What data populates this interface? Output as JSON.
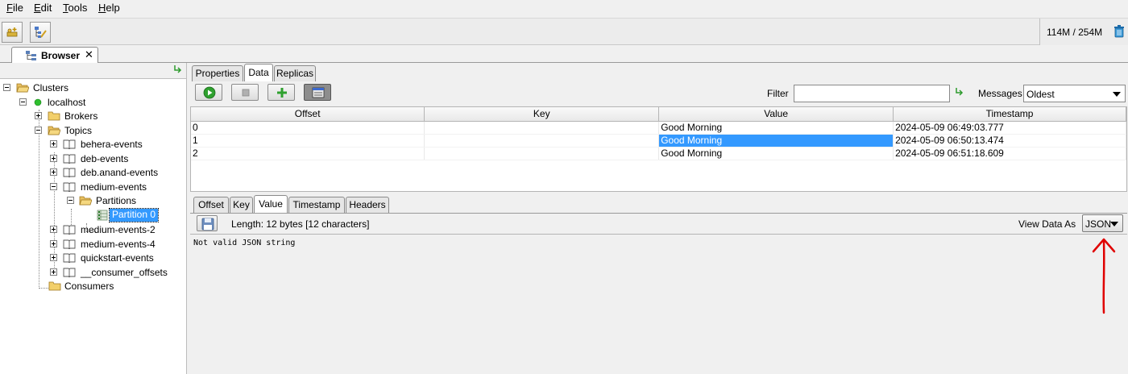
{
  "menu": {
    "items": [
      {
        "mnemonic": "F",
        "rest": "ile"
      },
      {
        "mnemonic": "E",
        "rest": "dit"
      },
      {
        "mnemonic": "T",
        "rest": "ools"
      },
      {
        "mnemonic": "H",
        "rest": "elp"
      }
    ]
  },
  "toolbar": {
    "buttons": [
      "new-connection-icon",
      "tree-edit-icon"
    ],
    "memory": "114M / 254M",
    "trash_icon": "trash-icon"
  },
  "browser_tab": {
    "label": "Browser",
    "close": "✕"
  },
  "tree": {
    "clusters": "Clusters",
    "host": "localhost",
    "brokers": "Brokers",
    "topics": "Topics",
    "topic_items": [
      "behera-events",
      "deb-events",
      "deb.anand-events",
      "medium-events"
    ],
    "partitions": "Partitions",
    "partition0": "Partition 0",
    "topic_items_after": [
      "medium-events-2",
      "medium-events-4",
      "quickstart-events",
      "__consumer_offsets"
    ],
    "consumers": "Consumers"
  },
  "upper_tabs": {
    "properties": "Properties",
    "data": "Data",
    "replicas": "Replicas",
    "active": "Data"
  },
  "filter": {
    "label": "Filter",
    "value": ""
  },
  "messages": {
    "label": "Messages",
    "value": "Oldest"
  },
  "table": {
    "columns": [
      "Offset",
      "Key",
      "Value",
      "Timestamp"
    ],
    "rows": [
      {
        "offset": "0",
        "key": "",
        "value": "Good Morning",
        "timestamp": "2024-05-09 06:49:03.777"
      },
      {
        "offset": "1",
        "key": "",
        "value": "Good Morning",
        "timestamp": "2024-05-09 06:50:13.474"
      },
      {
        "offset": "2",
        "key": "",
        "value": "Good Morning",
        "timestamp": "2024-05-09 06:51:18.609"
      }
    ],
    "selected_row": 1
  },
  "lower_tabs": {
    "offset": "Offset",
    "key": "Key",
    "value": "Value",
    "timestamp": "Timestamp",
    "headers": "Headers",
    "active": "Value"
  },
  "detail": {
    "length": "Length: 12 bytes [12 characters]",
    "view_label": "View Data As",
    "view_value": "JSON",
    "content": "Not valid JSON string"
  },
  "colors": {
    "selection": "#3399ff",
    "annotation": "#e00000",
    "brokers_status": "#2fbf2f"
  }
}
